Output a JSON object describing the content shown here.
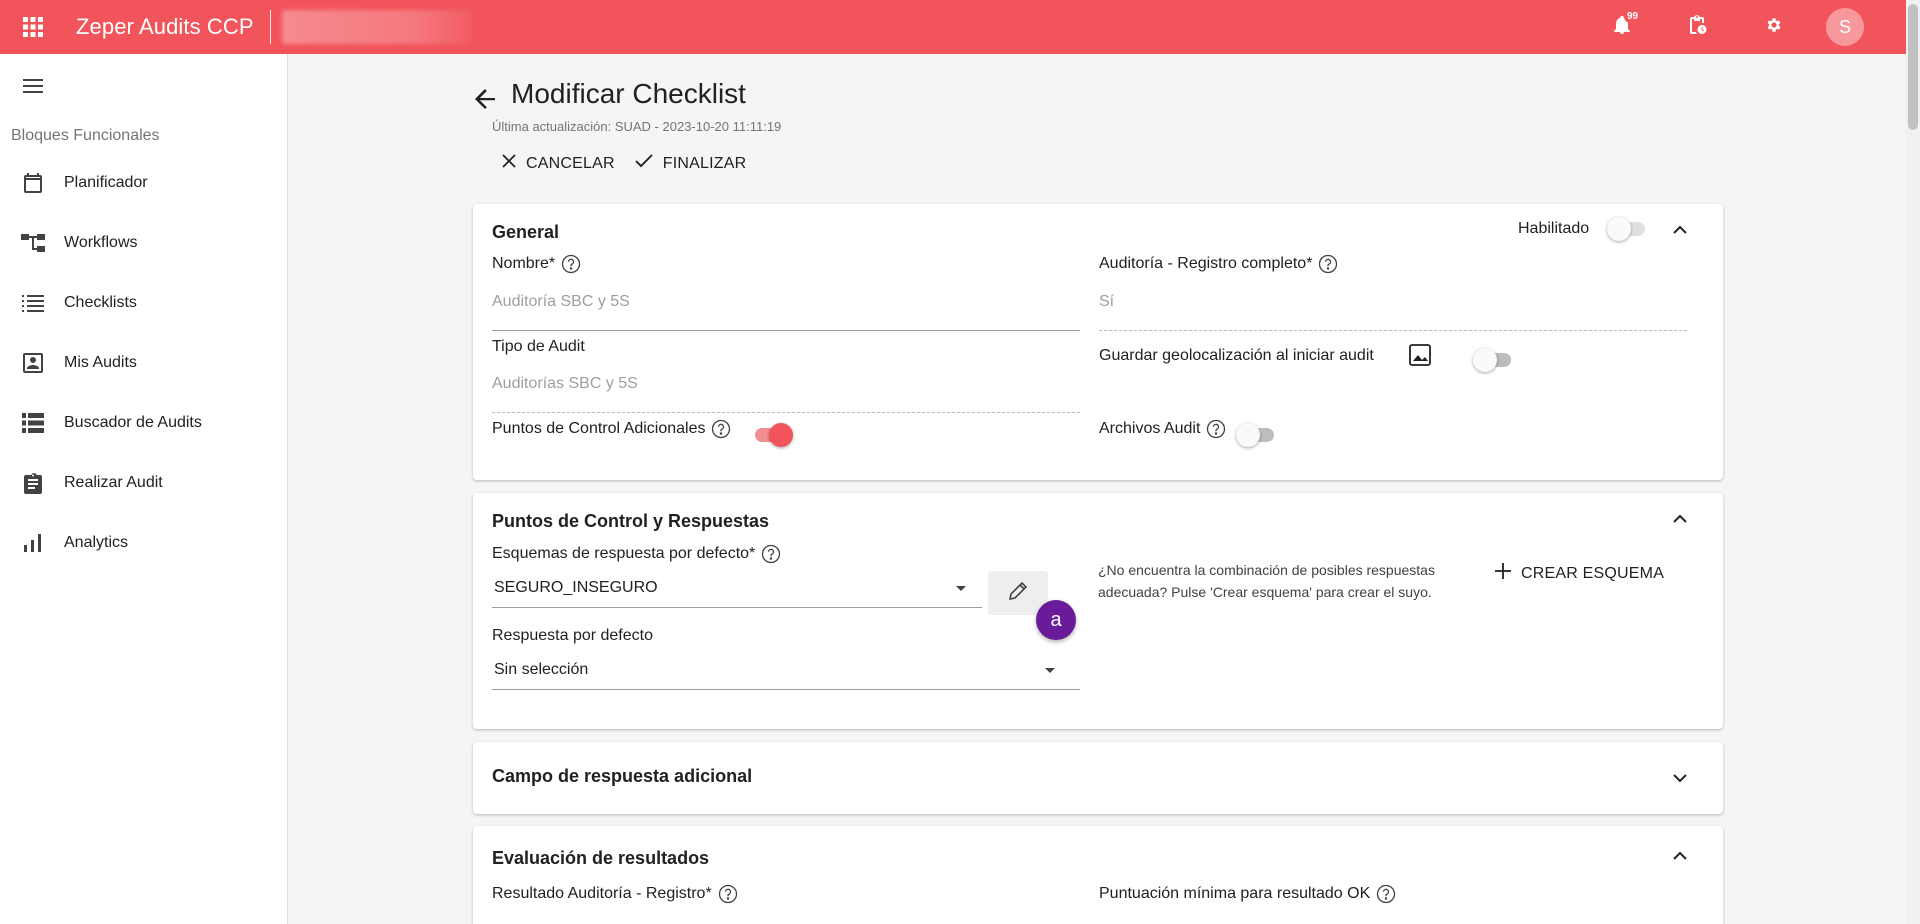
{
  "topbar": {
    "app_title": "Zeper Audits CCP",
    "notifications_count": "99",
    "avatar_initial": "S",
    "accent_color": "#f2545b"
  },
  "sidebar": {
    "caption": "Bloques Funcionales",
    "items": [
      {
        "label": "Planificador",
        "icon": "calendar-icon"
      },
      {
        "label": "Workflows",
        "icon": "workflow-icon"
      },
      {
        "label": "Checklists",
        "icon": "checklist-icon"
      },
      {
        "label": "Mis Audits",
        "icon": "person-box-icon"
      },
      {
        "label": "Buscador de Audits",
        "icon": "list-view-icon"
      },
      {
        "label": "Realizar Audit",
        "icon": "clipboard-icon"
      },
      {
        "label": "Analytics",
        "icon": "bar-chart-icon"
      }
    ]
  },
  "page": {
    "title": "Modificar Checklist",
    "last_update": "Última actualización: SUAD - 2023-10-20 11:11:19",
    "cancel_label": "CANCELAR",
    "finish_label": "FINALIZAR"
  },
  "general": {
    "title": "General",
    "enabled_label": "Habilitado",
    "enabled": false,
    "name_label": "Nombre*",
    "name_value": "Auditoría SBC y 5S",
    "full_record_label": "Auditoría - Registro completo*",
    "full_record_value": "Sí",
    "audit_type_label": "Tipo de Audit",
    "audit_type_value": "Auditorías SBC y 5S",
    "geo_label": "Guardar geolocalización al iniciar audit",
    "geo_enabled": false,
    "extra_points_label": "Puntos de Control Adicionales",
    "extra_points_enabled": true,
    "audit_files_label": "Archivos Audit",
    "audit_files_enabled": false
  },
  "control_points": {
    "title": "Puntos de Control y Respuestas",
    "schema_label": "Esquemas de respuesta por defecto*",
    "schema_value": "SEGURO_INSEGURO",
    "default_answer_label": "Respuesta por defecto",
    "default_answer_value": "Sin selección",
    "hint": "¿No encuentra la combinación de posibles respuestas adecuada? Pulse 'Crear esquema' para crear el suyo.",
    "create_label": "CREAR ESQUEMA",
    "annotation_badge": "a"
  },
  "additional_field": {
    "title": "Campo de respuesta adicional"
  },
  "evaluation": {
    "title": "Evaluación de resultados",
    "result_label": "Resultado Auditoría - Registro*",
    "min_score_label": "Puntuación mínima para resultado OK"
  }
}
